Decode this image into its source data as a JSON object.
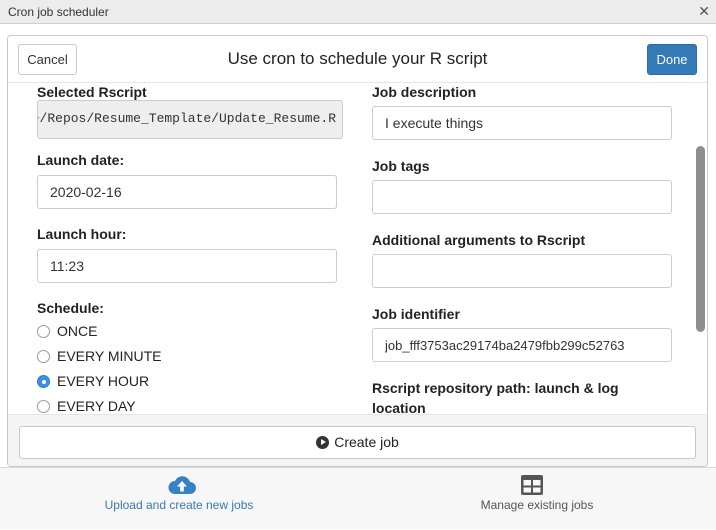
{
  "window": {
    "title": "Cron job scheduler",
    "close_glyph": "✕"
  },
  "dialog": {
    "title": "Use cron to schedule your R script",
    "cancel_label": "Cancel",
    "done_label": "Done"
  },
  "form": {
    "rscript_label": "Selected Rscript",
    "rscript_value": "~/Repos/Resume_Template/Update_Resume.R",
    "launch_date_label": "Launch date:",
    "launch_date_value": "2020-02-16",
    "launch_hour_label": "Launch hour:",
    "launch_hour_value": "11:23",
    "schedule_label": "Schedule:",
    "schedule_options": [
      "ONCE",
      "EVERY MINUTE",
      "EVERY HOUR",
      "EVERY DAY"
    ],
    "schedule_selected": "EVERY HOUR",
    "job_description_label": "Job description",
    "job_description_value": "I execute things",
    "job_tags_label": "Job tags",
    "job_tags_value": "",
    "additional_args_label": "Additional arguments to Rscript",
    "additional_args_value": "",
    "job_identifier_label": "Job identifier",
    "job_identifier_value": "job_fff3753ac29174ba2479fbb299c52763",
    "repo_path_label_line1": "Rscript repository path: launch & log",
    "repo_path_label_line2": "location"
  },
  "actions": {
    "create_job_label": "Create job"
  },
  "tabs": [
    {
      "label": "Upload and create new jobs",
      "icon": "cloud-upload-icon",
      "active": true
    },
    {
      "label": "Manage existing jobs",
      "icon": "table-icon",
      "active": false
    }
  ],
  "colors": {
    "primary": "#337ab7",
    "radio_checked": "#3b8fe5"
  }
}
